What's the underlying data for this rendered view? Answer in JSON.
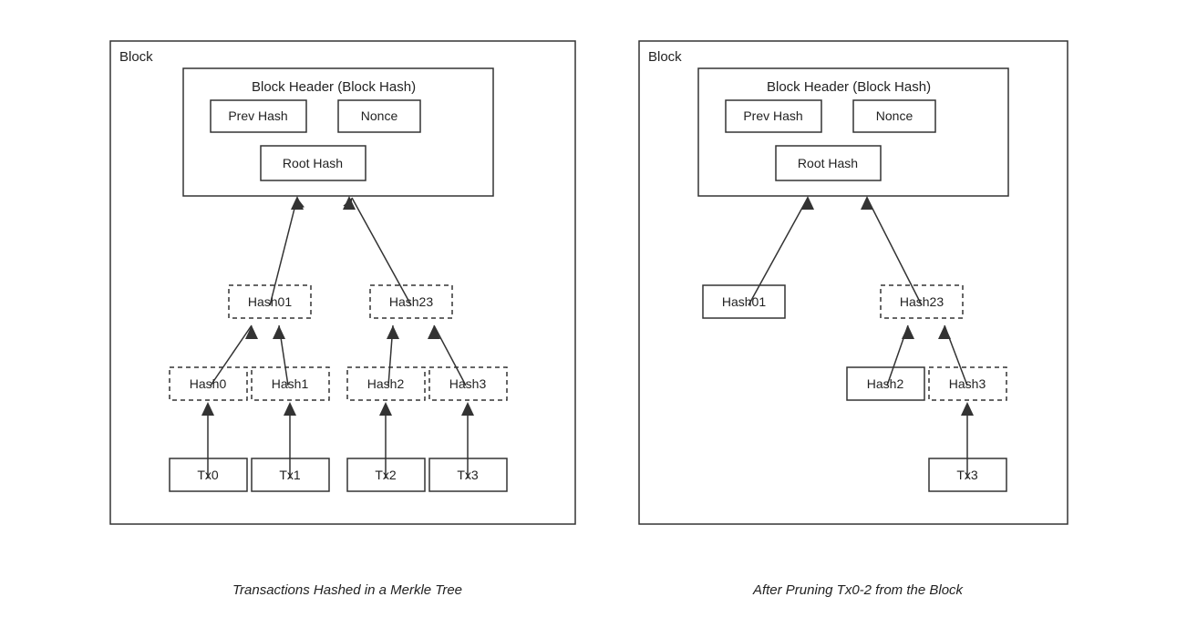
{
  "left": {
    "block_label": "Block",
    "header_title": "Block Header (Block Hash)",
    "prev_hash": "Prev Hash",
    "nonce": "Nonce",
    "root_hash": "Root Hash",
    "hash01": "Hash01",
    "hash23": "Hash23",
    "hash0": "Hash0",
    "hash1": "Hash1",
    "hash2": "Hash2",
    "hash3": "Hash3",
    "tx0": "Tx0",
    "tx1": "Tx1",
    "tx2": "Tx2",
    "tx3": "Tx3",
    "caption": "Transactions Hashed in a Merkle Tree"
  },
  "right": {
    "block_label": "Block",
    "header_title": "Block Header (Block Hash)",
    "prev_hash": "Prev Hash",
    "nonce": "Nonce",
    "root_hash": "Root Hash",
    "hash01": "Hash01",
    "hash23": "Hash23",
    "hash2": "Hash2",
    "hash3": "Hash3",
    "tx3": "Tx3",
    "caption": "After Pruning Tx0-2 from the Block"
  }
}
